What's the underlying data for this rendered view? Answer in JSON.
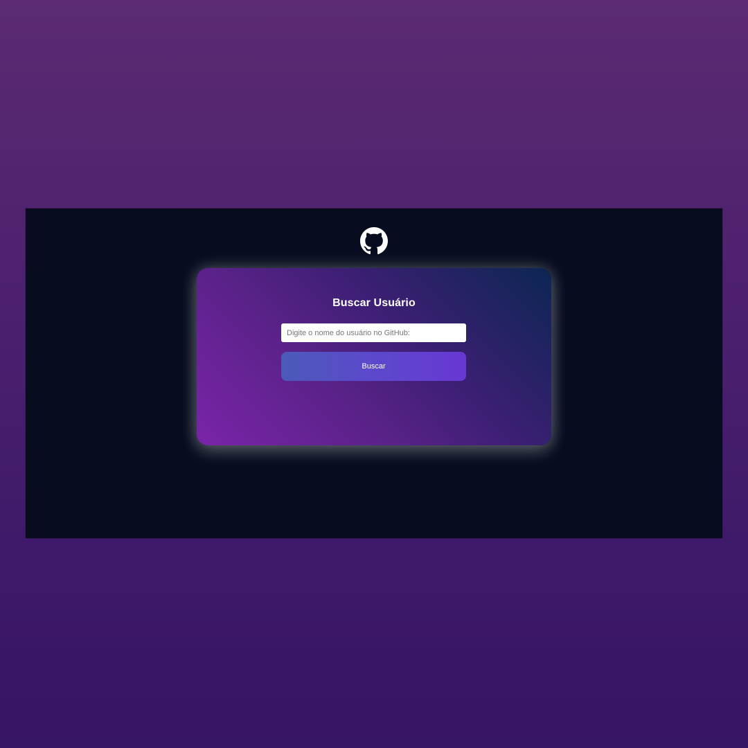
{
  "header": {
    "logo_icon": "github-icon"
  },
  "search": {
    "title": "Buscar Usuário",
    "placeholder": "Digite o nome do usuário no GitHub:",
    "value": "",
    "button_label": "Buscar"
  },
  "colors": {
    "page_background_top": "#5b2a72",
    "page_background_bottom": "#361466",
    "screen_background": "#070d1e",
    "card_gradient_start": "#7a24a8",
    "card_gradient_end": "#0c2653",
    "button_gradient_start": "#4b5ab8",
    "button_gradient_end": "#6838d3",
    "text_primary": "#ffffff"
  }
}
